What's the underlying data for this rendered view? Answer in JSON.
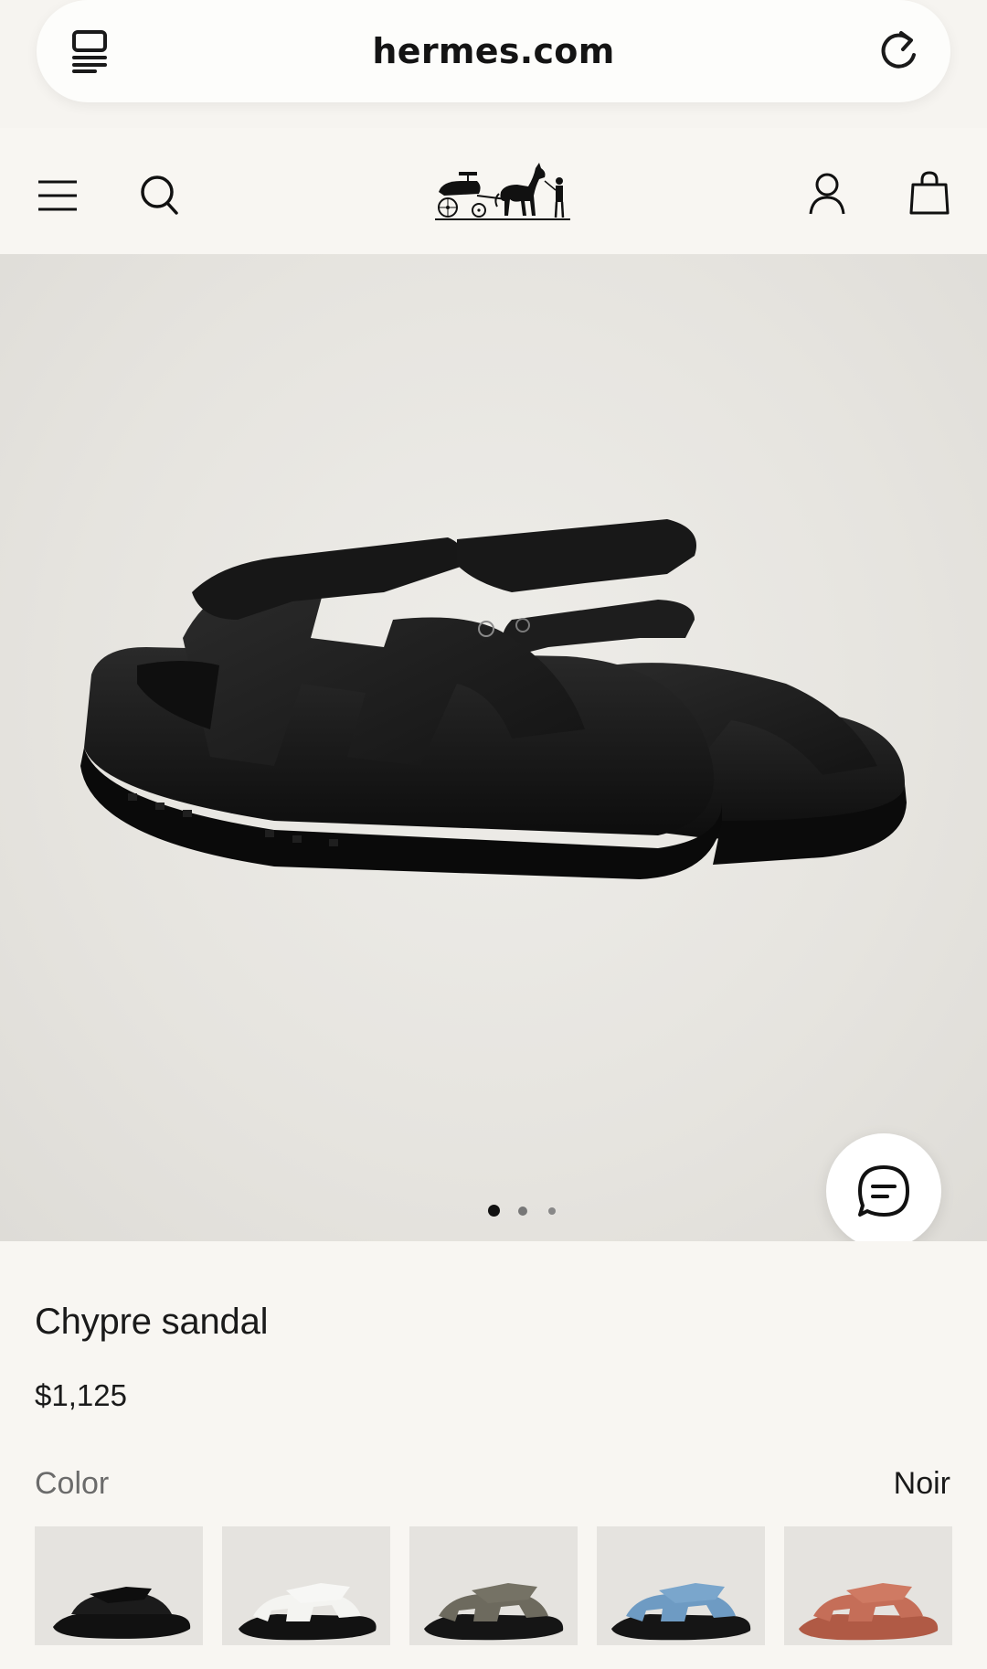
{
  "browser": {
    "url": "hermes.com",
    "tabs_icon": "tabs-icon",
    "reload_icon": "reload-icon"
  },
  "header": {
    "menu_icon": "hamburger-menu-icon",
    "search_icon": "search-icon",
    "logo": "hermes-carriage-logo",
    "account_icon": "account-icon",
    "bag_icon": "shopping-bag-icon"
  },
  "gallery": {
    "image_alt": "Chypre sandal",
    "dots_total": 3,
    "active_dot": 1,
    "chat_icon": "chat-icon"
  },
  "product": {
    "name": "Chypre sandal",
    "price": "$1,125"
  },
  "color": {
    "label": "Color",
    "selected": "Noir",
    "swatches": [
      {
        "name": "noir",
        "color": "#1b1b1b"
      },
      {
        "name": "white",
        "color": "#f4f4f1"
      },
      {
        "name": "taupe",
        "color": "#6d6a5e"
      },
      {
        "name": "blue",
        "color": "#6e9bc3"
      },
      {
        "name": "terracotta",
        "color": "#c56e58"
      }
    ]
  }
}
